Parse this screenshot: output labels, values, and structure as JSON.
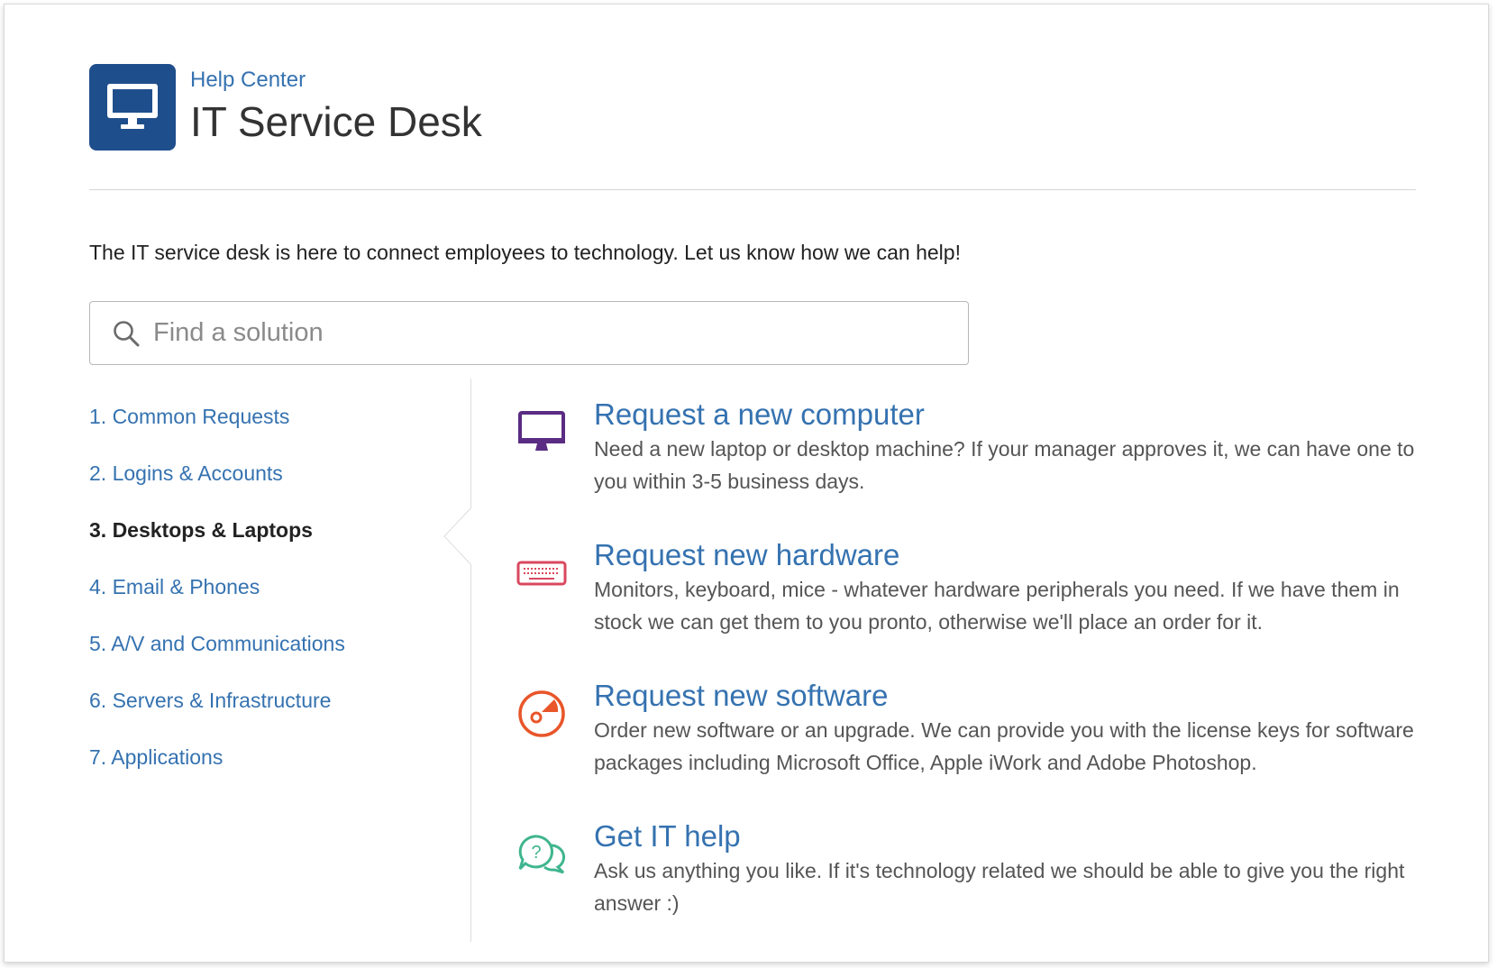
{
  "header": {
    "breadcrumb": "Help Center",
    "title": "IT Service Desk"
  },
  "intro": "The IT service desk is here to connect employees to technology. Let us know how we can help!",
  "search": {
    "placeholder": "Find a solution",
    "value": ""
  },
  "sidebar": {
    "active_index": 2,
    "items": [
      {
        "label": "1. Common Requests"
      },
      {
        "label": "2. Logins & Accounts"
      },
      {
        "label": "3. Desktops & Laptops"
      },
      {
        "label": "4. Email & Phones"
      },
      {
        "label": "5. A/V and Communications"
      },
      {
        "label": "6. Servers & Infrastructure"
      },
      {
        "label": "7. Applications"
      }
    ]
  },
  "requests": [
    {
      "icon": "monitor-icon",
      "title": "Request a new computer",
      "description": "Need a new laptop or desktop machine? If your manager approves it, we can have one to you within 3-5 business days.",
      "color": "#5b2c83"
    },
    {
      "icon": "keyboard-icon",
      "title": "Request new hardware",
      "description": "Monitors, keyboard, mice - whatever hardware peripherals you need. If we have them in stock we can get them to you pronto, otherwise we'll place an order for it.",
      "color": "#d9485f"
    },
    {
      "icon": "software-disc-icon",
      "title": "Request new software",
      "description": "Order new software or an upgrade. We can provide you with the license keys for software packages including Microsoft Office, Apple iWork and Adobe Photoshop.",
      "color": "#e8562a"
    },
    {
      "icon": "help-chat-icon",
      "title": "Get IT help",
      "description": "Ask us anything you like. If it's technology related we should be able to give you the right answer :)",
      "color": "#3fb58f"
    }
  ],
  "colors": {
    "brand": "#1f4e8c",
    "link": "#3572b0"
  }
}
